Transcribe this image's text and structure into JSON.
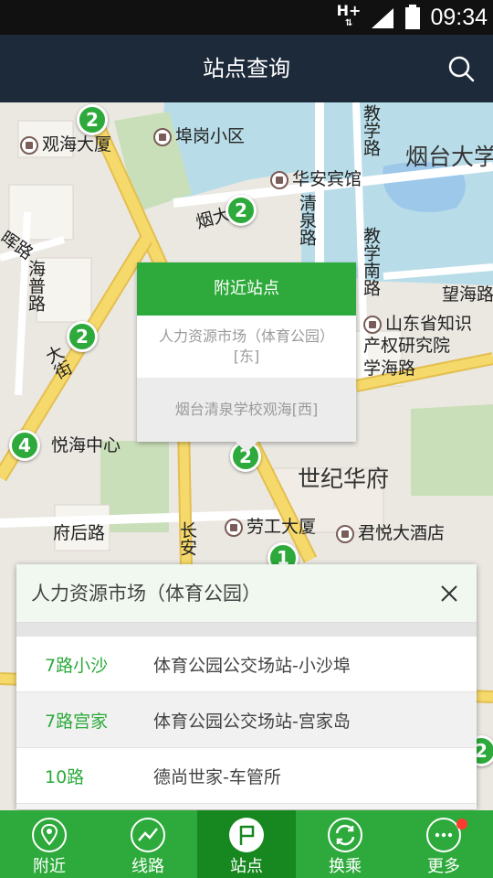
{
  "status_bar": {
    "network": "H+",
    "battery_level": "40",
    "time": "09:34"
  },
  "header": {
    "title": "站点查询",
    "search_icon": "search-icon"
  },
  "map": {
    "labels": {
      "guanhai_building": "观海大厦",
      "bugang_community": "埠岗小区",
      "yantai_university": "烟台大学",
      "huaan_hotel": "华安宾馆",
      "qingquan_road": "清泉路",
      "jiaoyu_road": "教学路",
      "jiaoyu_south_road": "教学南路",
      "wanghai_road": "望海路",
      "shandong_ip": "山东省知识产权研究院",
      "xuehai_road": "学海路",
      "shiji_huafu": "世纪华府",
      "laogong_building": "劳工大厦",
      "junyue_hotel": "君悦大酒店",
      "yuehai_center": "悦海中心",
      "fuhou_road": "府后路",
      "changan": "长安",
      "haijing_road": "海普路",
      "datie_street": "大街",
      "left_road": "晖路",
      "yan_fragment": "烟大"
    },
    "stops": [
      "2",
      "2",
      "2",
      "4",
      "2",
      "1",
      "2"
    ]
  },
  "popup": {
    "title": "附近站点",
    "items": [
      "人力资源市场（体育公园）[东]",
      "烟台清泉学校观海[西]"
    ]
  },
  "station_panel": {
    "name": "人力资源市场（体育公园）",
    "routes": [
      {
        "route": "7路小沙",
        "direction": "体育公园公交场站-小沙埠"
      },
      {
        "route": "7路宫家",
        "direction": "体育公园公交场站-宫家岛"
      },
      {
        "route": "10路",
        "direction": "德尚世家-车管所"
      }
    ]
  },
  "nav": {
    "items": [
      {
        "label": "附近",
        "icon": "location-pin-icon"
      },
      {
        "label": "线路",
        "icon": "route-line-icon"
      },
      {
        "label": "站点",
        "icon": "flag-icon"
      },
      {
        "label": "换乘",
        "icon": "transfer-icon"
      },
      {
        "label": "更多",
        "icon": "more-icon"
      }
    ],
    "active": "站点"
  },
  "colors": {
    "accent": "#2daa3b",
    "header": "#1d2a3a",
    "road": "#f2d36b"
  }
}
